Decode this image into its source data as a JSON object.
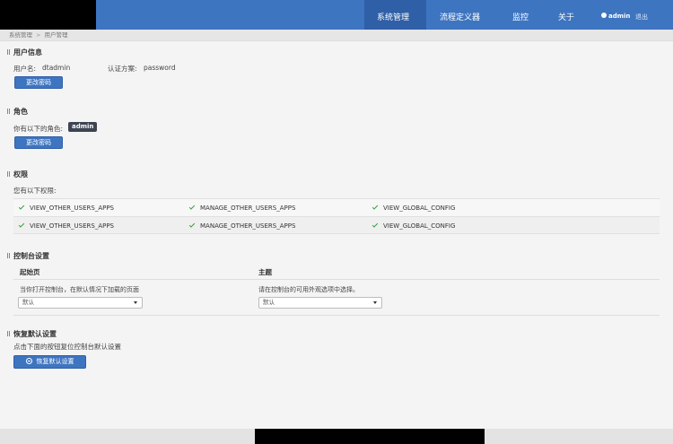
{
  "nav": {
    "items": [
      {
        "label": "系统管理",
        "active": true
      },
      {
        "label": "流程定义器",
        "active": false
      },
      {
        "label": "监控",
        "active": false
      },
      {
        "label": "关于",
        "active": false
      }
    ],
    "user": "admin",
    "user_icon": "user-icon",
    "logout": "退出",
    "color": "#3e75c1"
  },
  "breadcrumb": {
    "root": "系统管理",
    "separator": ">",
    "current": "用户管理"
  },
  "user_info": {
    "title": "用户信息",
    "username_label": "用户名:",
    "username": "dtadmin",
    "auth_label": "认证方案:",
    "auth": "password",
    "change_password": "更改密码"
  },
  "roles": {
    "title": "角色",
    "label": "你有以下的角色:",
    "role": "admin",
    "button": "更改密码"
  },
  "permissions": {
    "title": "权限",
    "label": "您有以下权限:",
    "check_color": "#2e9e3e",
    "rows": [
      [
        "VIEW_OTHER_USERS_APPS",
        "MANAGE_OTHER_USERS_APPS",
        "VIEW_GLOBAL_CONFIG"
      ],
      [
        "VIEW_OTHER_USERS_APPS",
        "MANAGE_OTHER_USERS_APPS",
        "VIEW_GLOBAL_CONFIG"
      ]
    ]
  },
  "console": {
    "title": "控制台设置",
    "start_page": {
      "header": "起始页",
      "desc": "当你打开控制台，在默认情况下加载的页面",
      "value": "默认"
    },
    "theme": {
      "header": "主题",
      "desc": "请在控制台的可用外观选项中选择。",
      "value": "默认"
    }
  },
  "restore": {
    "title": "恢复默认设置",
    "desc": "点击下面的按钮复位控制台默认设置",
    "button": "恢复默认设置",
    "icon": "reset-icon"
  }
}
